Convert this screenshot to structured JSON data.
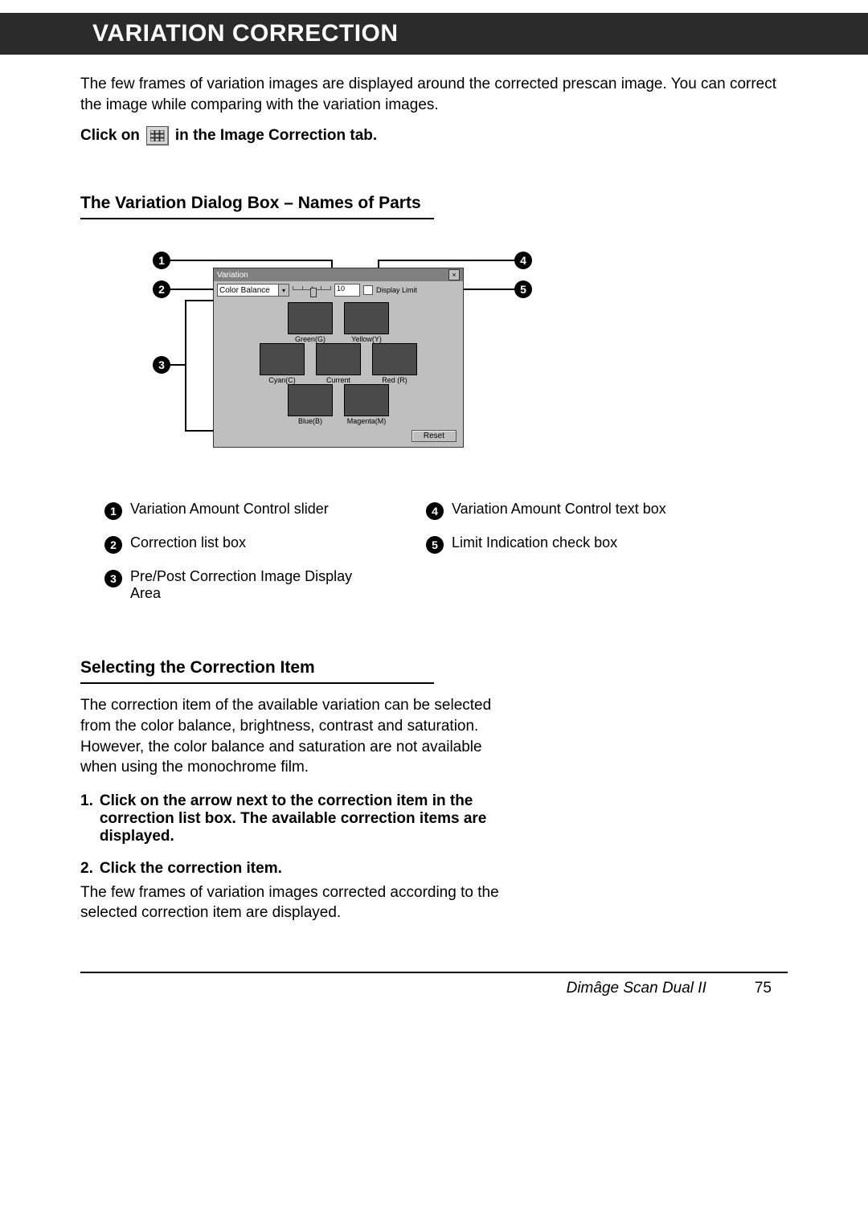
{
  "header": {
    "title": "VARIATION CORRECTION"
  },
  "intro": "The few frames of variation images are displayed around the corrected prescan image. You can correct the image while comparing with the variation images.",
  "click_instruction": {
    "before": "Click on",
    "after": "in the Image Correction tab."
  },
  "section1": {
    "heading": "The Variation Dialog Box – Names of Parts",
    "dialog": {
      "title": "Variation",
      "dropdown_value": "Color Balance",
      "amount_value": "10",
      "checkbox_label": "Display Limit",
      "thumbs": {
        "row1": [
          "Green(G)",
          "Yellow(Y)"
        ],
        "row2": [
          "Cyan(C)",
          "Current",
          "Red (R)"
        ],
        "row3": [
          "Blue(B)",
          "Magenta(M)"
        ]
      },
      "reset": "Reset"
    },
    "callouts": {
      "c1": "1",
      "c2": "2",
      "c3": "3",
      "c4": "4",
      "c5": "5"
    },
    "legend": {
      "l1": "Variation Amount Control slider",
      "l2": "Correction list box",
      "l3": "Pre/Post Correction Image Display Area",
      "l4": "Variation Amount Control text box",
      "l5": "Limit Indication check box"
    }
  },
  "section2": {
    "heading": "Selecting the Correction Item",
    "body": "The correction item of the available variation can be selected from the color balance, brightness, contrast and saturation. However, the color balance and saturation are not available when using the monochrome film.",
    "step1_num": "1.",
    "step1": "Click on the arrow next to the correction item in the correction list box. The available correction items are displayed.",
    "step2_num": "2.",
    "step2": "Click the correction item.",
    "after": "The few frames of variation images corrected according to the selected correction item are displayed."
  },
  "footer": {
    "product": "Dimâge Scan Dual II",
    "page": "75"
  }
}
